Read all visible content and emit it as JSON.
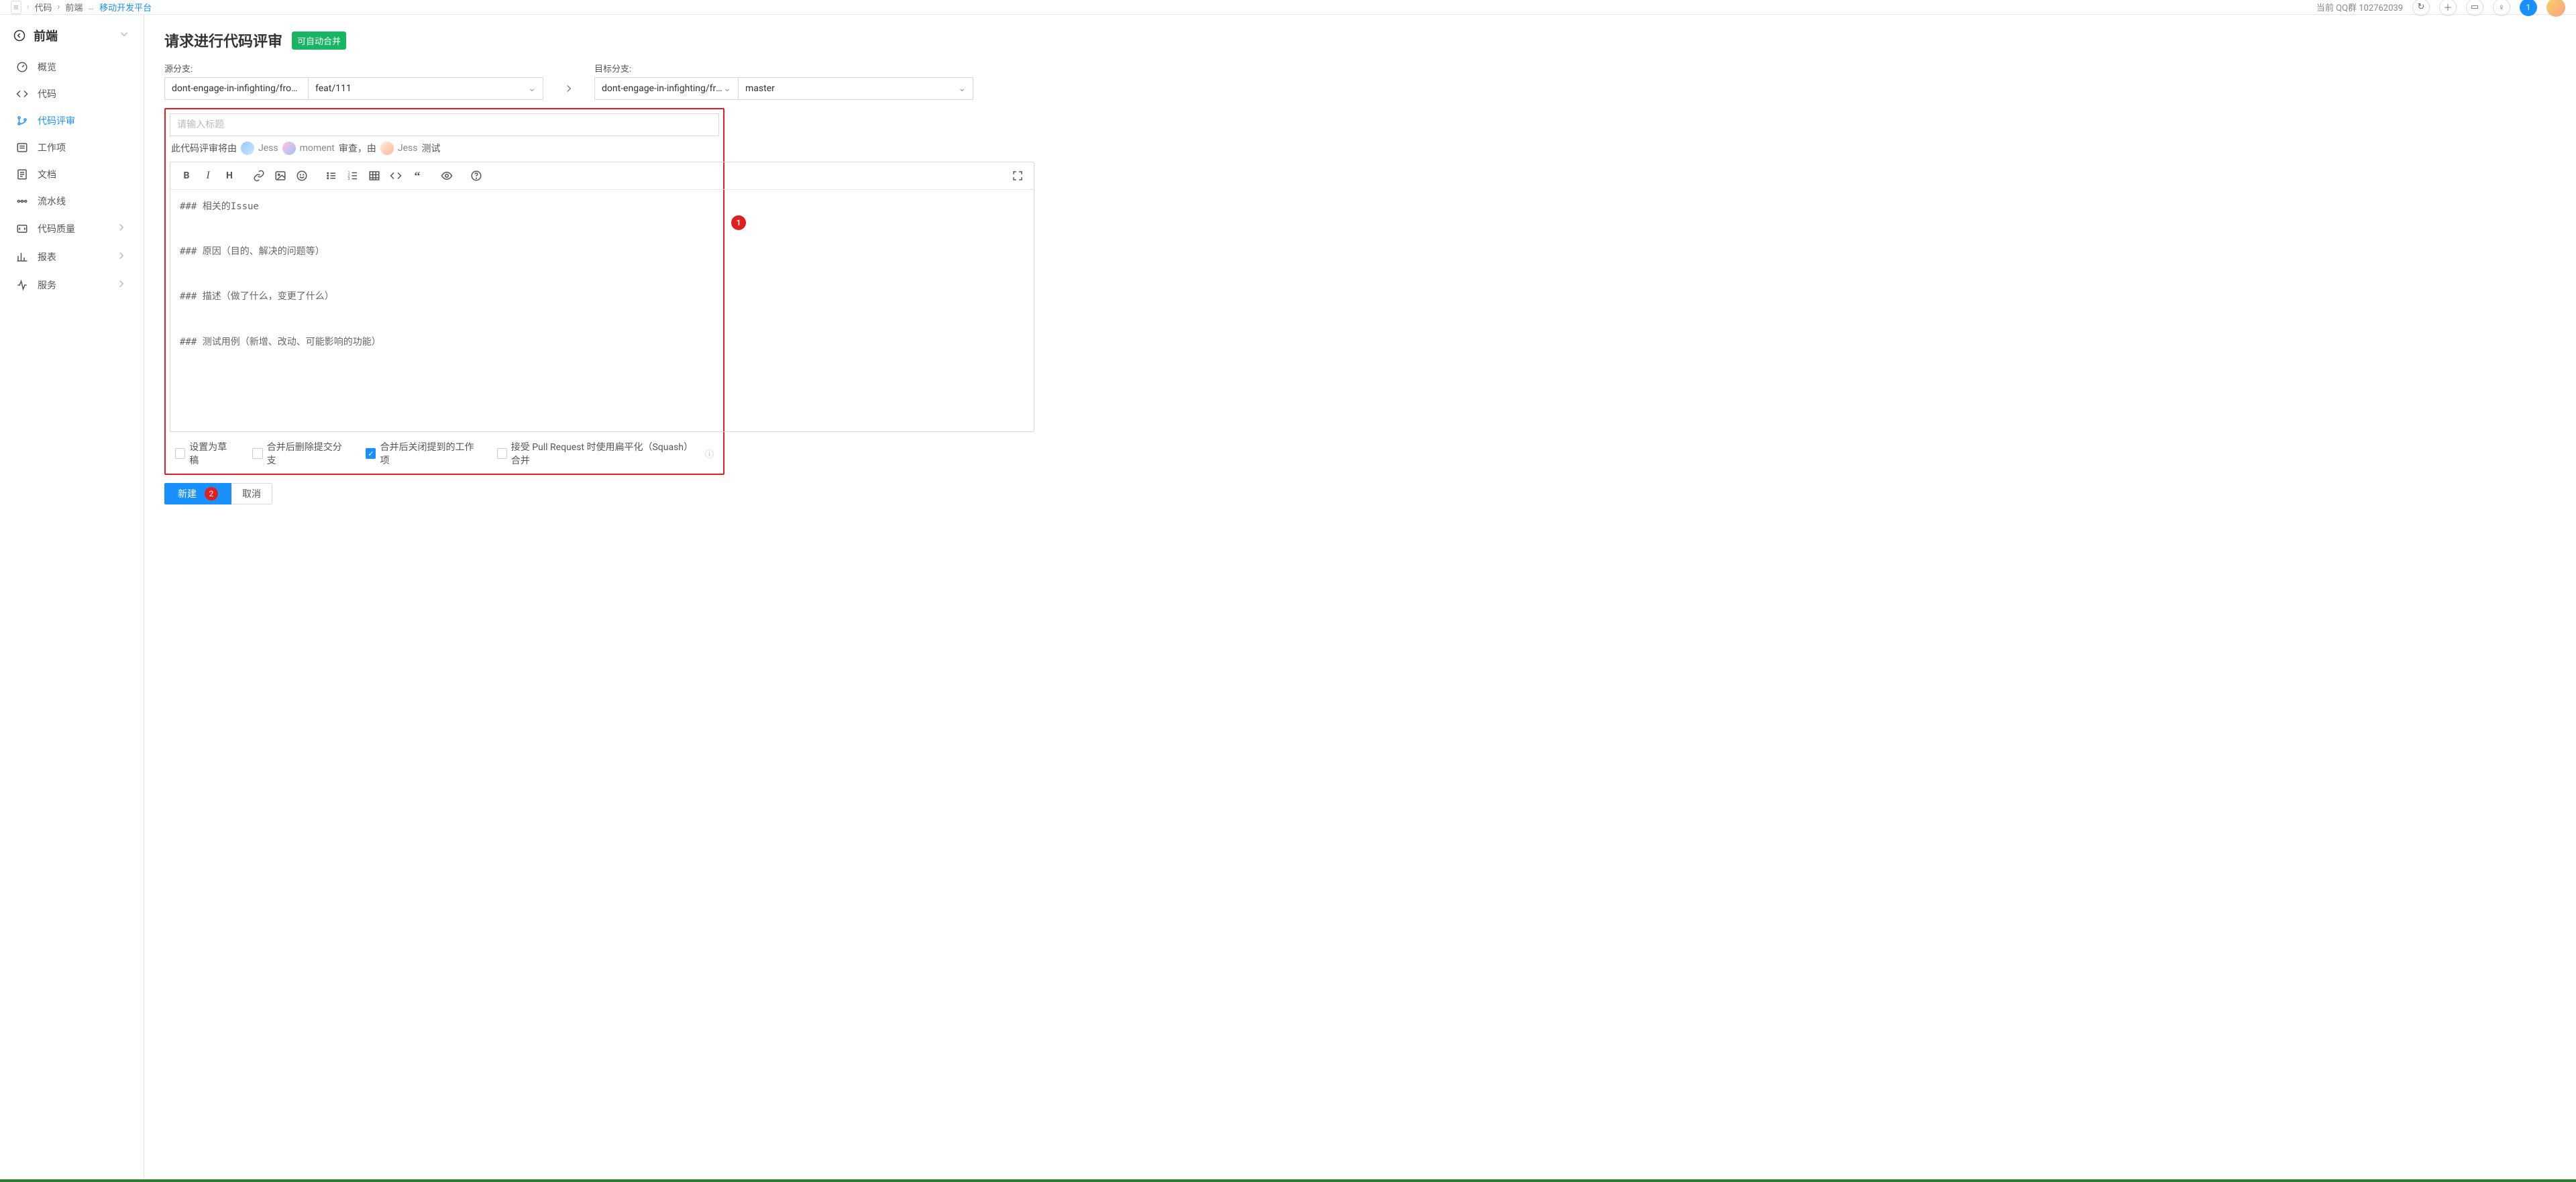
{
  "top": {
    "breadcrumb": [
      "代码",
      "前端"
    ],
    "breadcrumb_link": "移动开发平台",
    "account_label": "当前 QQ群 102762039",
    "num_badge": "1"
  },
  "sidebar": {
    "title": "前端",
    "items": [
      {
        "label": "概览"
      },
      {
        "label": "代码"
      },
      {
        "label": "代码评审",
        "active": true
      },
      {
        "label": "工作项"
      },
      {
        "label": "文档"
      },
      {
        "label": "流水线"
      },
      {
        "label": "代码质量",
        "expandable": true
      },
      {
        "label": "报表",
        "expandable": true
      },
      {
        "label": "服务",
        "expandable": true
      }
    ]
  },
  "page": {
    "title": "请求进行代码评审",
    "badge": "可自动合并",
    "source_label": "源分支:",
    "target_label": "目标分支:",
    "source_repo": "dont-engage-in-infighting/front-end",
    "source_branch": "feat/111",
    "target_repo": "dont-engage-in-infighting/front-end",
    "target_branch": "master"
  },
  "form": {
    "title_placeholder": "请输入标题",
    "review_prefix": "此代码评审将由",
    "reviewer1": "Jess",
    "reviewer2": "moment",
    "review_mid": "审查，由",
    "tester": "Jess",
    "review_suffix": "测试",
    "editor_body": "### 相关的Issue\n\n\n### 原因（目的、解决的问题等）\n\n\n### 描述（做了什么，变更了什么）\n\n\n### 测试用例（新增、改动、可能影响的功能）",
    "checks": [
      {
        "label": "设置为草稿",
        "checked": false
      },
      {
        "label": "合并后删除提交分支",
        "checked": false
      },
      {
        "label": "合并后关闭提到的工作项",
        "checked": true
      },
      {
        "label": "接受 Pull Request 时使用扁平化（Squash）合并",
        "checked": false,
        "help": true
      }
    ],
    "callout1": "1",
    "callout2": "2",
    "submit": "新建",
    "cancel": "取消"
  }
}
